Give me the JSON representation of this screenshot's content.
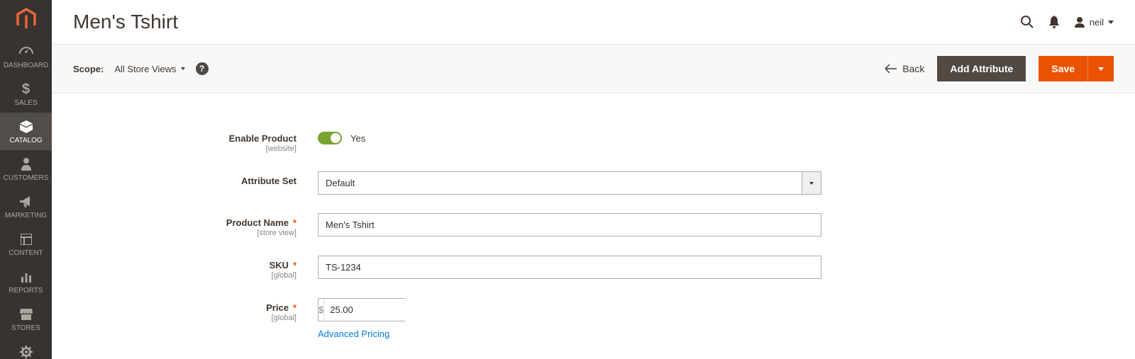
{
  "sidebar": {
    "items": [
      {
        "label": "DASHBOARD",
        "name": "nav-dashboard"
      },
      {
        "label": "SALES",
        "name": "nav-sales"
      },
      {
        "label": "CATALOG",
        "name": "nav-catalog"
      },
      {
        "label": "CUSTOMERS",
        "name": "nav-customers"
      },
      {
        "label": "MARKETING",
        "name": "nav-marketing"
      },
      {
        "label": "CONTENT",
        "name": "nav-content"
      },
      {
        "label": "REPORTS",
        "name": "nav-reports"
      },
      {
        "label": "STORES",
        "name": "nav-stores"
      }
    ]
  },
  "header": {
    "title": "Men's Tshirt",
    "user": "neil"
  },
  "toolbar": {
    "scope_label": "Scope:",
    "scope_value": "All Store Views",
    "back_label": "Back",
    "add_attribute_label": "Add Attribute",
    "save_label": "Save"
  },
  "form": {
    "enable_product": {
      "label": "Enable Product",
      "sublabel": "[website]",
      "value_text": "Yes"
    },
    "attribute_set": {
      "label": "Attribute Set",
      "value": "Default"
    },
    "product_name": {
      "label": "Product Name",
      "sublabel": "[store view]",
      "value": "Men's Tshirt"
    },
    "sku": {
      "label": "SKU",
      "sublabel": "[global]",
      "value": "TS-1234"
    },
    "price": {
      "label": "Price",
      "sublabel": "[global]",
      "currency": "$",
      "value": "25.00",
      "advanced_link": "Advanced Pricing"
    }
  }
}
